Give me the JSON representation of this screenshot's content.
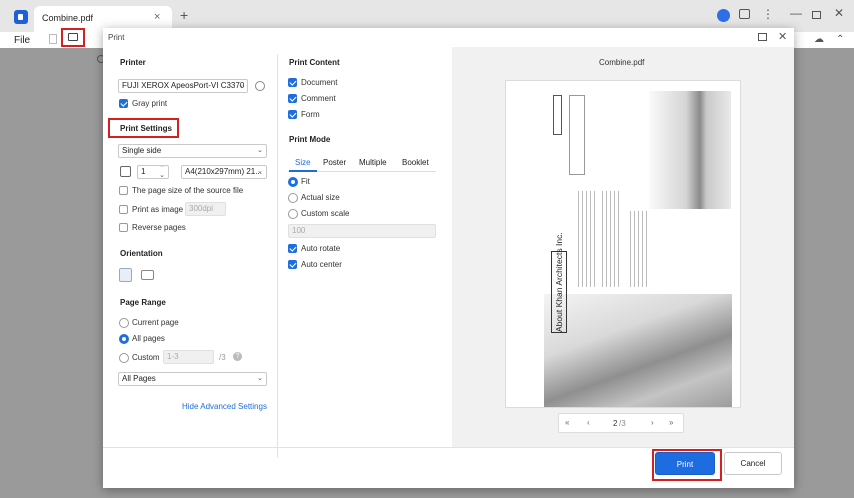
{
  "app": {
    "tab_title": "Combine.pdf",
    "tab_close": "×",
    "new_tab": "+",
    "more": "⋮",
    "minimize": "—",
    "close": "✕",
    "file_menu": "File"
  },
  "dialog": {
    "title": "Print",
    "close": "✕",
    "printer": {
      "heading": "Printer",
      "selected": "FUJI XEROX ApeosPort-VI C3370",
      "gray_print_label": "Gray print",
      "gray_print_checked": true
    },
    "print_settings": {
      "heading": "Print Settings",
      "sides": "Single side",
      "copies": "1",
      "paper_size": "A4(210x297mm) 21...",
      "page_size_source_label": "The page size of the source file",
      "print_as_image_label": "Print as image",
      "print_as_image_dpi": "300dpi",
      "reverse_pages_label": "Reverse pages"
    },
    "orientation": {
      "heading": "Orientation"
    },
    "page_range": {
      "heading": "Page Range",
      "current_page": "Current page",
      "all_pages": "All pages",
      "custom": "Custom",
      "custom_placeholder": "1-3",
      "custom_total": "/3",
      "subset": "All Pages"
    },
    "hide_advanced": "Hide Advanced Settings",
    "print_content": {
      "heading": "Print Content",
      "document": "Document",
      "comment": "Comment",
      "form": "Form"
    },
    "print_mode": {
      "heading": "Print Mode",
      "tabs": [
        "Size",
        "Poster",
        "Multiple",
        "Booklet"
      ],
      "fit": "Fit",
      "actual_size": "Actual size",
      "custom_scale": "Custom scale",
      "scale_value": "100",
      "auto_rotate": "Auto rotate",
      "auto_center": "Auto center"
    },
    "preview": {
      "filename": "Combine.pdf",
      "current_page": "2",
      "total_pages": "/3",
      "page_heading": "About Khan Architects Inc."
    },
    "buttons": {
      "print": "Print",
      "cancel": "Cancel"
    }
  },
  "colors": {
    "accent": "#1e6de0",
    "highlight": "#d42020"
  }
}
